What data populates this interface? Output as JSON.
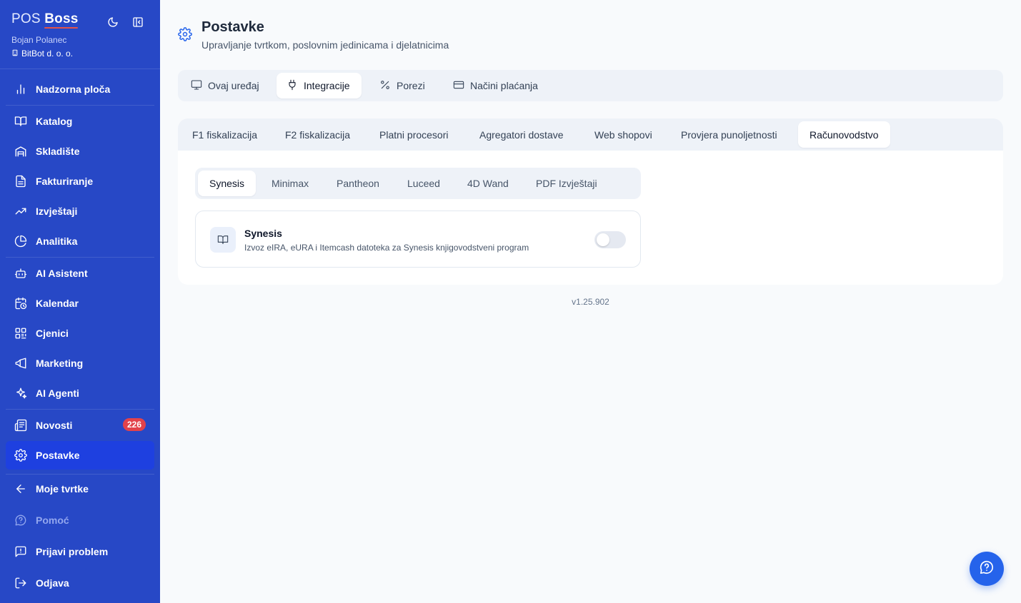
{
  "brand": {
    "prefix": "POS",
    "name": "Boss"
  },
  "user": {
    "name": "Bojan Polanec",
    "company": "BitBot d. o. o."
  },
  "sidebar": {
    "items": [
      {
        "label": "Nadzorna ploča",
        "icon": "bar-chart-icon"
      },
      {
        "label": "Katalog",
        "icon": "book-icon"
      },
      {
        "label": "Skladište",
        "icon": "warehouse-icon"
      },
      {
        "label": "Fakturiranje",
        "icon": "invoice-icon"
      },
      {
        "label": "Izvještaji",
        "icon": "trending-up-icon"
      },
      {
        "label": "Analitika",
        "icon": "pie-chart-icon"
      },
      {
        "label": "AI Asistent",
        "icon": "bot-icon"
      },
      {
        "label": "Kalendar",
        "icon": "calendar-clock-icon"
      },
      {
        "label": "Cjenici",
        "icon": "qr-code-icon"
      },
      {
        "label": "Marketing",
        "icon": "megaphone-icon"
      },
      {
        "label": "AI Agenti",
        "icon": "sparkles-icon"
      },
      {
        "label": "Novosti",
        "icon": "newspaper-icon",
        "badge": "226"
      },
      {
        "label": "Postavke",
        "icon": "settings-gear-icon",
        "active": true
      },
      {
        "label": "Moje tvrtke",
        "icon": "arrow-left-icon"
      },
      {
        "label": "Pomoć",
        "icon": "help-circle-icon",
        "muted": true
      },
      {
        "label": "Prijavi problem",
        "icon": "message-alert-icon"
      },
      {
        "label": "Odjava",
        "icon": "logout-icon"
      }
    ]
  },
  "page": {
    "title": "Postavke",
    "subtitle": "Upravljanje tvrtkom, poslovnim jedinicama i djelatnicima"
  },
  "tabs_main": [
    {
      "label": "Ovaj uređaj",
      "icon": "monitor-icon"
    },
    {
      "label": "Integracije",
      "icon": "plug-icon",
      "active": true
    },
    {
      "label": "Porezi",
      "icon": "percent-icon"
    },
    {
      "label": "Načini plaćanja",
      "icon": "credit-card-icon"
    }
  ],
  "tabs_integrations": [
    {
      "label": "F1 fiskalizacija"
    },
    {
      "label": "F2 fiskalizacija"
    },
    {
      "label": "Platni procesori"
    },
    {
      "label": "Agregatori dostave"
    },
    {
      "label": "Web shopovi"
    },
    {
      "label": "Provjera punoljetnosti"
    },
    {
      "label": "Računovodstvo",
      "active": true
    }
  ],
  "tabs_accounting": [
    {
      "label": "Synesis",
      "active": true
    },
    {
      "label": "Minimax"
    },
    {
      "label": "Pantheon"
    },
    {
      "label": "Luceed"
    },
    {
      "label": "4D Wand"
    },
    {
      "label": "PDF Izvještaji"
    }
  ],
  "integration": {
    "name": "Synesis",
    "description": "Izvoz eIRA, eURA i Itemcash datoteka za Synesis knjigovodstveni program",
    "enabled": false
  },
  "version": "v1.25.902",
  "colors": {
    "sidebar": "#2748c6",
    "active": "#1e40e0",
    "badge": "#e2424b",
    "fab": "#2563eb"
  }
}
